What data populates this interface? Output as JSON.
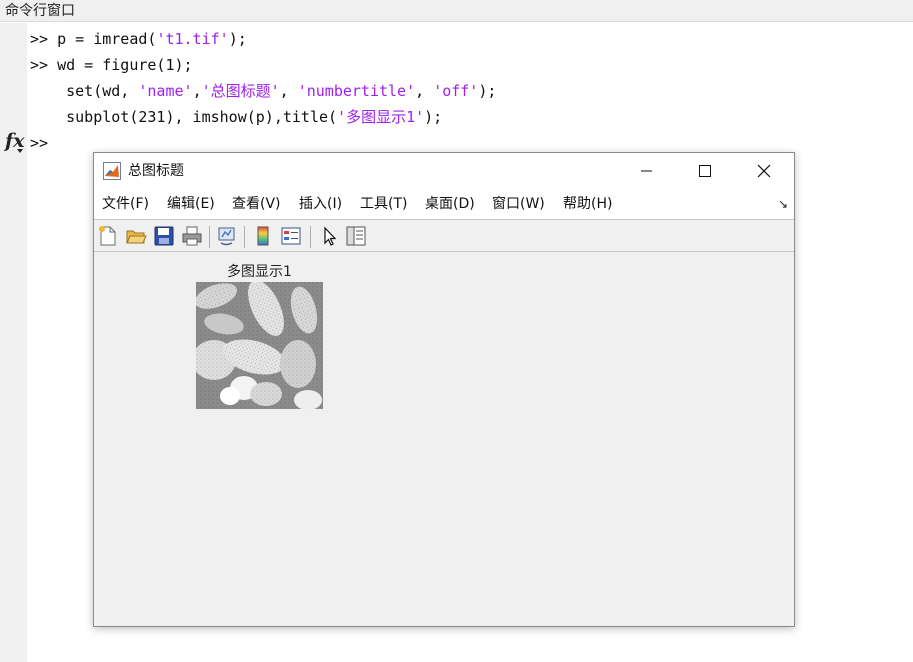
{
  "command_window": {
    "title": "命令行窗口",
    "lines": [
      [
        {
          "t": ">> p = imread("
        },
        {
          "t": "'t1.tif'",
          "s": 1
        },
        {
          "t": ");"
        }
      ],
      [
        {
          "t": ">> wd = figure(1);"
        }
      ],
      [
        {
          "t": "    set(wd, "
        },
        {
          "t": "'name'",
          "s": 1
        },
        {
          "t": ","
        },
        {
          "t": "'总图标题'",
          "s": 1
        },
        {
          "t": ", "
        },
        {
          "t": "'numbertitle'",
          "s": 1
        },
        {
          "t": ", "
        },
        {
          "t": "'off'",
          "s": 1
        },
        {
          "t": ");"
        }
      ],
      [
        {
          "t": "    subplot(231), imshow(p),title("
        },
        {
          "t": "'多图显示1'",
          "s": 1
        },
        {
          "t": ");"
        }
      ],
      [
        {
          "t": ">>"
        }
      ]
    ],
    "fx_label": "fx"
  },
  "figure": {
    "title": "总图标题",
    "menu": [
      "文件(F)",
      "编辑(E)",
      "查看(V)",
      "插入(I)",
      "工具(T)",
      "桌面(D)",
      "窗口(W)",
      "帮助(H)"
    ],
    "toolbar_icons": [
      "new-figure-icon",
      "open-file-icon",
      "save-icon",
      "print-icon",
      "link-plot-icon",
      "colorbar-icon",
      "legend-icon",
      "pointer-icon",
      "property-inspector-icon"
    ],
    "subplot_title": "多图显示1"
  },
  "colors": {
    "string": "#a020f0"
  }
}
